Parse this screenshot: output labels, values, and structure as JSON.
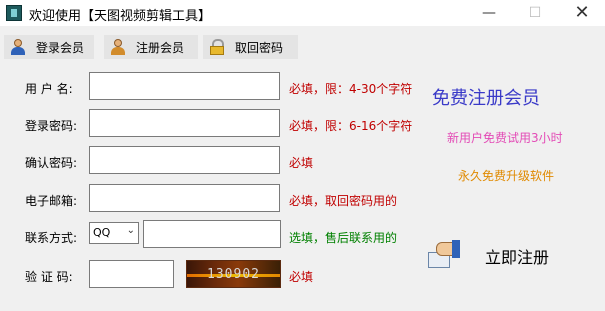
{
  "window": {
    "title": "欢迎使用【天图视频剪辑工具】",
    "minimize": "—",
    "maximize": "☐",
    "close": "✕"
  },
  "toolbar": {
    "login": "登录会员",
    "register": "注册会员",
    "recover": "取回密码"
  },
  "form": {
    "username": {
      "label": "用 户 名:",
      "value": "",
      "hint": "必填，限：4-30个字符"
    },
    "password": {
      "label": "登录密码:",
      "value": "",
      "hint": "必填，限：6-16个字符"
    },
    "confirm": {
      "label": "确认密码:",
      "value": "",
      "hint": "必填"
    },
    "email": {
      "label": "电子邮箱:",
      "value": "",
      "hint": "必填，取回密码用的"
    },
    "contact": {
      "label": "联系方式:",
      "type_selected": "QQ",
      "value": "",
      "hint": "选填，售后联系用的"
    },
    "captcha": {
      "label": "验 证 码:",
      "value": "",
      "code": "130902",
      "hint": "必填"
    }
  },
  "promo": {
    "title": "免费注册会员",
    "line1": "新用户免费试用3小时",
    "line2": "永久免费升级软件"
  },
  "register_button": {
    "label": "立即注册"
  },
  "colors": {
    "required_hint": "#c00000",
    "optional_hint": "#008000",
    "promo_title": "#3a3ac8",
    "promo_line1": "#e34bb6",
    "promo_line2": "#e08a00"
  }
}
